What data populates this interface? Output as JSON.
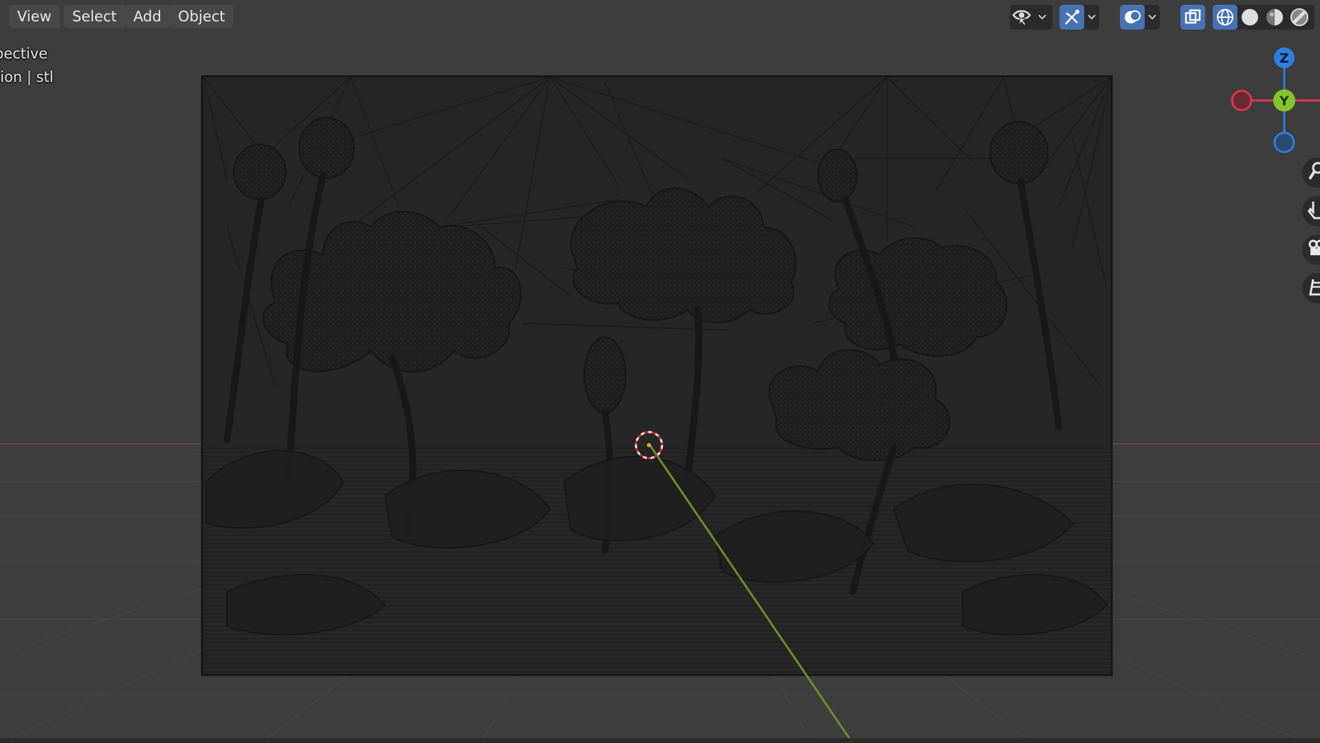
{
  "menu": {
    "view": "View",
    "select": "Select",
    "add": "Add",
    "object": "Object"
  },
  "overlay": {
    "line1": "pective",
    "line2": "tion | stl"
  },
  "gizmo": {
    "z_label": "Z",
    "y_label": "Y"
  },
  "header_icons": [
    "view-object-types-icon",
    "gizmo-toggle-icon",
    "overlays-icon",
    "xray-icon",
    "wireframe-shading-icon",
    "solid-shading-icon",
    "material-shading-icon",
    "rendered-shading-icon"
  ],
  "nav_tools": [
    "zoom-icon",
    "pan-hand-icon",
    "camera-icon",
    "orthographic-grid-icon"
  ],
  "colors": {
    "background": "#3d3d3d",
    "x_axis": "#e0364f",
    "y_axis": "#84c42c",
    "z_axis": "#2c7fe0",
    "active_toggle": "#4772b3",
    "mesh": "#1c1c1c"
  }
}
